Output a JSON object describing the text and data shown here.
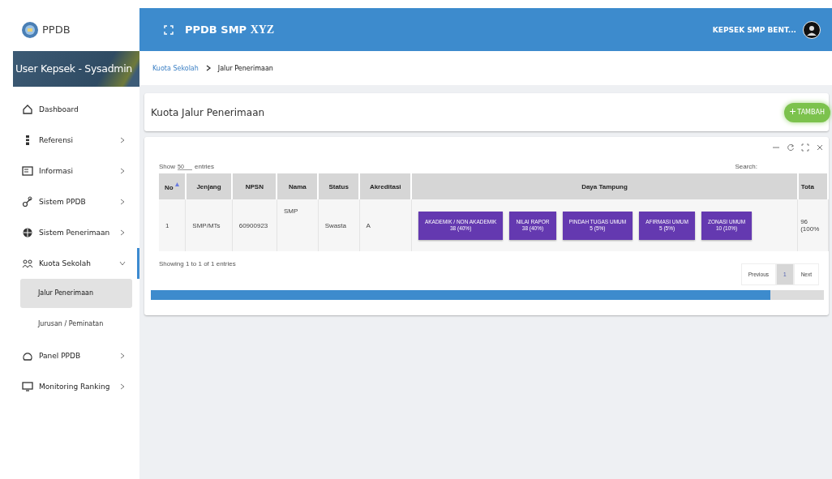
{
  "brand": {
    "name": "PPDB"
  },
  "header": {
    "title": "PPDB SMP",
    "title_suffix": "XYZ",
    "user": "KEPSEK SMP BENT..."
  },
  "sidebar": {
    "user_banner": "User Kepsek - Sysadmin",
    "items": [
      {
        "label": "Dashboard",
        "selected": false
      },
      {
        "label": "Referensi",
        "selected": false,
        "expanded": false
      },
      {
        "label": "Informasi",
        "selected": false,
        "expanded": false
      },
      {
        "label": "Sistem PPDB",
        "selected": false,
        "expanded": false
      },
      {
        "label": "Sistem Penerimaan",
        "selected": false,
        "expanded": false
      },
      {
        "label": "Kuota Sekolah",
        "selected": true,
        "expanded": true,
        "children": [
          {
            "label": "Jalur Penerimaan",
            "selected": true
          },
          {
            "label": "Jurusan / Peminatan",
            "selected": false
          }
        ]
      },
      {
        "label": "Panel PPDB",
        "selected": false,
        "expanded": false
      },
      {
        "label": "Monitoring Ranking",
        "selected": false,
        "expanded": false
      }
    ]
  },
  "breadcrumb": [
    "Kuota Sekolah",
    "Jalur Penerimaan"
  ],
  "page_title": "Kuota Jalur Penerimaan",
  "add_button": "TAMBAH",
  "table": {
    "show_label": "Show",
    "page_length": "50",
    "entries_label": "entries",
    "search_label": "Search:",
    "columns": [
      "No",
      "Jenjang",
      "NPSN",
      "Nama",
      "Status",
      "Akreditasi",
      "Daya Tampung",
      "Tota"
    ],
    "rows": [
      {
        "no": "1",
        "jenjang": "SMP/MTs",
        "npsn": "60900923",
        "nama": "SMP",
        "status": "Swasta",
        "akreditasi": "A",
        "daya_tampung": [
          {
            "label": "AKADEMIK / NON AKADEMIK",
            "value": "38 (40%)"
          },
          {
            "label": "NILAI RAPOR",
            "value": "38 (40%)"
          },
          {
            "label": "PINDAH TUGAS UMUM",
            "value": "5 (5%)"
          },
          {
            "label": "AFIRMASI UMUM",
            "value": "5 (5%)"
          },
          {
            "label": "ZONASI UMUM",
            "value": "10 (10%)"
          }
        ],
        "total": [
          "96",
          "(100%"
        ]
      }
    ],
    "info": "Showing 1 to 1 of 1 entries",
    "pagination": [
      {
        "label": "Previous",
        "selected": false
      },
      {
        "label": "1",
        "selected": true
      },
      {
        "label": "Next",
        "selected": false
      }
    ]
  }
}
